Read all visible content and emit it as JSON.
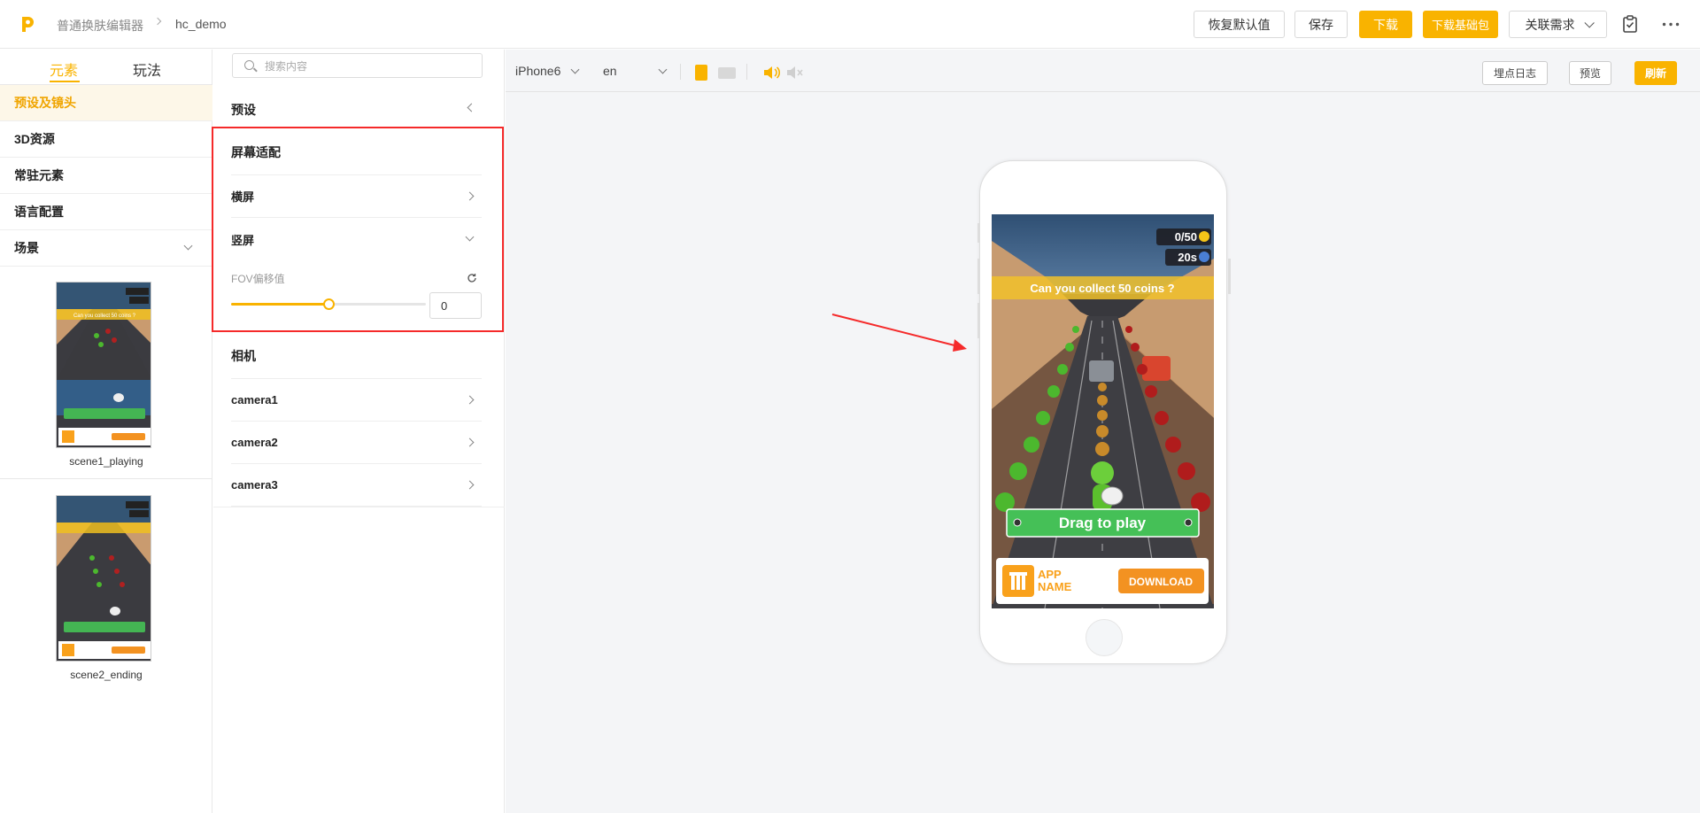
{
  "topbar": {
    "breadcrumb": [
      "普通换肤编辑器",
      "hc_demo"
    ],
    "buttons": {
      "restore": "恢复默认值",
      "save": "保存",
      "download": "下载",
      "download_base": "下载基础包",
      "related": "关联需求"
    },
    "colors": {
      "accent": "#f9b300"
    }
  },
  "left": {
    "tabs": [
      "元素",
      "玩法"
    ],
    "active_tab": "元素",
    "nav": [
      "预设及镜头",
      "3D资源",
      "常驻元素",
      "语言配置",
      "场景"
    ],
    "scenes": [
      {
        "name": "scene1_playing"
      },
      {
        "name": "scene2_ending"
      }
    ]
  },
  "mid": {
    "search_placeholder": "搜索内容",
    "preset_title": "预设",
    "screen_title": "屏幕适配",
    "landscape": "横屏",
    "portrait": "竖屏",
    "fov_label": "FOV偏移值",
    "fov_value": "0",
    "fov_slider_fraction": 0.5,
    "camera_title": "相机",
    "cameras": [
      "camera1",
      "camera2",
      "camera3"
    ]
  },
  "stage": {
    "device": "iPhone6",
    "language": "en",
    "buttons": {
      "log": "埋点日志",
      "preview": "预览",
      "refresh": "刷新"
    }
  },
  "game": {
    "coins": "0/50",
    "time": "20s",
    "banner": "Can you collect 50 coins ?",
    "cta": "Drag to play",
    "app_name_1": "APP",
    "app_name_2": "NAME",
    "download": "DOWNLOAD",
    "thumb_banner": "Can you collect 50 coins ?"
  }
}
